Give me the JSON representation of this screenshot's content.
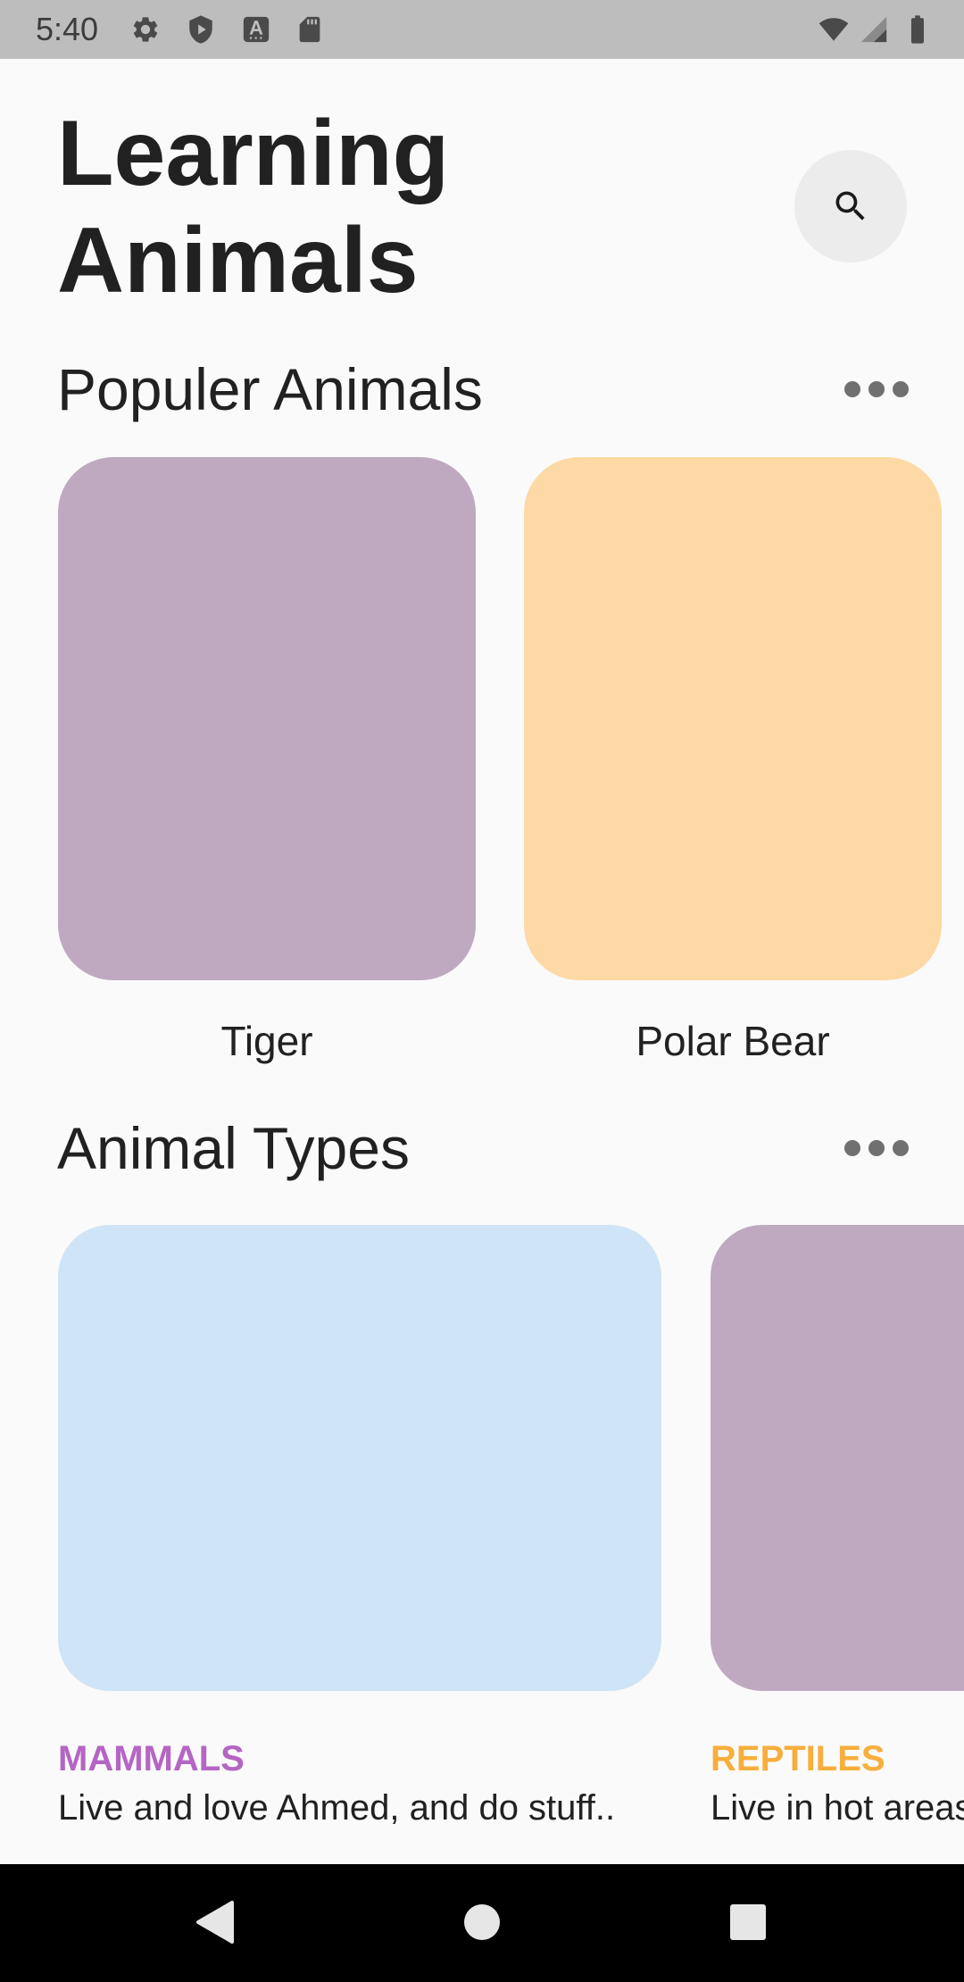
{
  "status_bar": {
    "time": "5:40",
    "left_icons": [
      "settings-icon",
      "shield-play-icon",
      "font-a-icon",
      "sd-card-icon"
    ],
    "right_icons": [
      "wifi-icon",
      "cell-signal-icon",
      "battery-icon"
    ]
  },
  "header": {
    "title_line1": "Learning",
    "title_line2": "Animals",
    "search_icon": "search-icon"
  },
  "popular": {
    "title": "Populer Animals",
    "more_icon": "more-horizontal-icon",
    "items": [
      {
        "name": "Tiger",
        "color": "#bfa9c1"
      },
      {
        "name": "Polar Bear",
        "color": "#fdd9a5"
      }
    ]
  },
  "types": {
    "title": "Animal Types",
    "more_icon": "more-horizontal-icon",
    "items": [
      {
        "name": "MAMMALS",
        "name_color": "#b565c4",
        "description": "Live and love Ahmed, and do stuff..",
        "color": "#d0e4f7"
      },
      {
        "name": "REPTILES",
        "name_color": "#f7ae3c",
        "description": "Live in hot areas",
        "color": "#bfa9c1"
      }
    ]
  },
  "nav_bar": {
    "icons": [
      "back-triangle-icon",
      "home-circle-icon",
      "recents-square-icon"
    ]
  }
}
